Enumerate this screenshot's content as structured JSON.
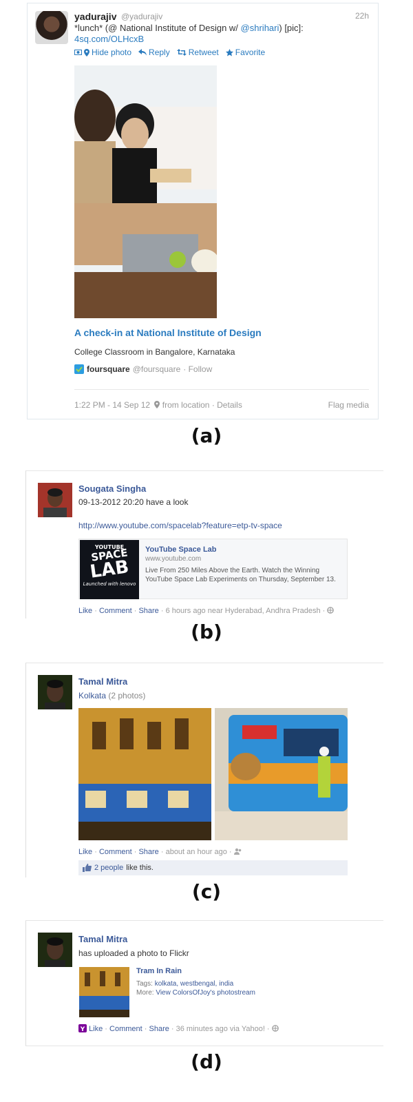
{
  "panel_a": {
    "author_name": "yadurajiv",
    "author_handle": "@yadurajiv",
    "time": "22h",
    "text_1": "*lunch* (@ National Institute of Design w/ ",
    "mention": "@shrihari",
    "text_2": ") [pic]:",
    "link": "4sq.com/OLHcxB",
    "actions": {
      "hide_photo": "Hide photo",
      "reply": "Reply",
      "retweet": "Retweet",
      "favorite": "Favorite"
    },
    "checkin_title": "A check-in at National Institute of Design",
    "checkin_sub": "College Classroom in Bangalore, Karnataka",
    "foursquare_name": "foursquare",
    "foursquare_handle": "@foursquare",
    "follow": "· Follow",
    "timestamp": "1:22 PM - 14 Sep 12",
    "location": "from location",
    "details": "· Details",
    "flag": "Flag media",
    "caption": "(a)"
  },
  "panel_b": {
    "name": "Sougata Singha",
    "status": "09-13-2012 20:20 have a look",
    "url": "http://www.youtube.com/spacelab?feature=etp-tv-space",
    "thumb_line1": "YOUTUBE",
    "thumb_line2": "SPACE",
    "thumb_line3": "LAB",
    "thumb_line4": "Launched with lenovo",
    "preview_title": "YouTube Space Lab",
    "preview_domain": "www.youtube.com",
    "preview_desc": "Live From 250 Miles Above the Earth. Watch the Winning YouTube Space Lab Experiments on Thursday, September 13.",
    "like": "Like",
    "comment": "Comment",
    "share": "Share",
    "meta": "· 6 hours ago near Hyderabad, Andhra Pradesh ·",
    "caption": "(b)"
  },
  "panel_c": {
    "name": "Tamal Mitra",
    "album": "Kolkata",
    "album_count": "(2 photos)",
    "like": "Like",
    "comment": "Comment",
    "share": "Share",
    "meta": "· about an hour ago ·",
    "likes_people": "2 people",
    "likes_text": "like this.",
    "caption": "(c)"
  },
  "panel_d": {
    "name": "Tamal Mitra",
    "status": "has uploaded a photo to Flickr",
    "photo_title": "Tram In Rain",
    "tags_label": "Tags:",
    "tags": "kolkata, westbengal, india",
    "more_label": "More:",
    "more_link": "View ColorsOfJoy's photostream",
    "like": "Like",
    "comment": "Comment",
    "share": "Share",
    "meta": "· 36 minutes ago via Yahoo! ·",
    "caption": "(d)"
  }
}
